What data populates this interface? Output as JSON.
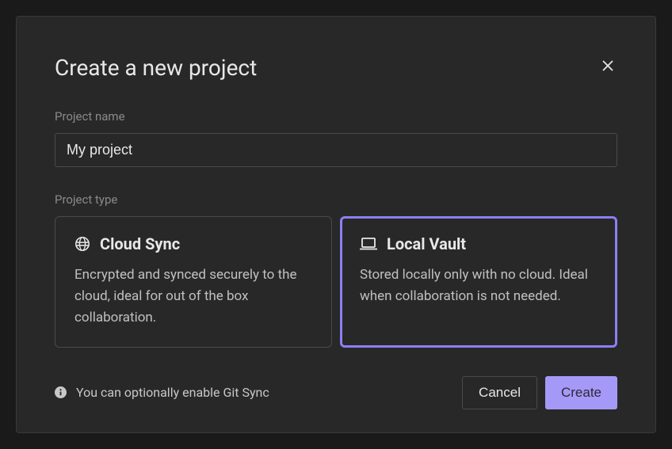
{
  "dialog": {
    "title": "Create a new project"
  },
  "fields": {
    "name_label": "Project name",
    "name_value": "My project",
    "type_label": "Project type"
  },
  "types": [
    {
      "title": "Cloud Sync",
      "desc": "Encrypted and synced securely to the cloud, ideal for out of the box collaboration.",
      "selected": false
    },
    {
      "title": "Local Vault",
      "desc": "Stored locally only with no cloud. Ideal when collaboration is not needed.",
      "selected": true
    }
  ],
  "hint": "You can optionally enable Git Sync",
  "actions": {
    "cancel": "Cancel",
    "create": "Create"
  }
}
